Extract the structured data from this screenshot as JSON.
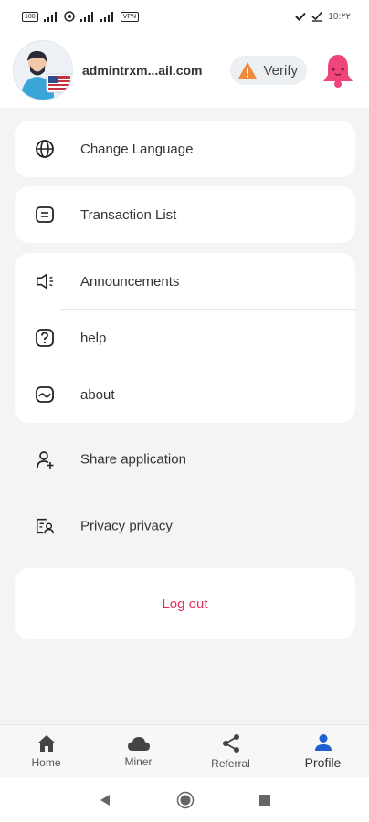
{
  "status_bar": {
    "battery": "100",
    "vpn": "VPN",
    "time": "10:۲۲"
  },
  "header": {
    "email": "admintrxm...ail.com",
    "verify_label": "Verify"
  },
  "menu": {
    "change_language": "Change Language",
    "transaction_list": "Transaction List",
    "announcements": "Announcements",
    "help": "help",
    "about": "about",
    "share_application": "Share application",
    "privacy": "Privacy privacy",
    "logout": "Log out"
  },
  "bottom_nav": {
    "items": [
      {
        "label": "Home",
        "icon": "home-icon"
      },
      {
        "label": "Miner",
        "icon": "cloud-icon"
      },
      {
        "label": "Referral",
        "icon": "share-icon"
      },
      {
        "label": "Profile",
        "icon": "person-icon"
      }
    ],
    "active": "Profile"
  },
  "colors": {
    "accent_blue": "#1f5fd0",
    "logout_red": "#e0305a",
    "bell_pink": "#f0457a",
    "warning_orange": "#f08a3c"
  }
}
